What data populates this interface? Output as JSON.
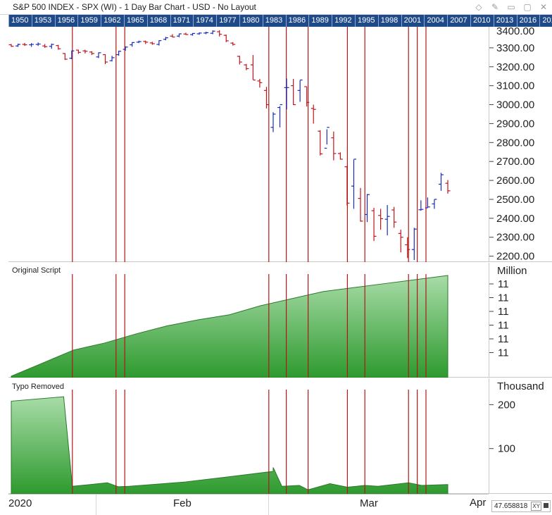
{
  "window": {
    "title": "S&P 500 INDEX - SPX (WI) - 1 Day Bar Chart - USD - No Layout",
    "icons": [
      "diamond-icon",
      "pin-icon",
      "minimize-icon",
      "maximize-icon",
      "close-icon"
    ]
  },
  "year_scroller": [
    "1950",
    "1953",
    "1956",
    "1959",
    "1962",
    "1965",
    "1968",
    "1971",
    "1974",
    "1977",
    "1980",
    "1983",
    "1986",
    "1989",
    "1992",
    "1995",
    "1998",
    "2001",
    "2004",
    "2007",
    "2010",
    "2013",
    "2016",
    "201"
  ],
  "price_panel": {
    "y_ticks": [
      "3300.00",
      "3200.00",
      "3100.00",
      "3000.00",
      "2900.00",
      "2800.00",
      "2700.00",
      "2600.00",
      "2500.00",
      "2400.00",
      "2300.00",
      "2200.00"
    ],
    "top_tick_partial": "3400.00"
  },
  "panel2": {
    "label": "Original Script",
    "unit": "Million",
    "y_ticks": [
      "11",
      "11",
      "11",
      "11",
      "11",
      "11"
    ]
  },
  "panel3": {
    "label": "Typo Removed",
    "unit": "Thousand",
    "y_ticks": [
      "200",
      "100"
    ]
  },
  "x_axis": {
    "ticks": [
      "2020",
      "Feb",
      "Mar"
    ],
    "next": "Apr"
  },
  "readout": {
    "value": "47.658818",
    "mode": "XY"
  },
  "colors": {
    "up": "#1a2bbf",
    "down": "#c0141a",
    "marker_line": "#b01818",
    "area_top": "#a8dca8",
    "area_bottom": "#2e9a2e",
    "year_bar": "#1f4a8a"
  },
  "chart_data": [
    {
      "type": "bar",
      "subtype": "ohlc",
      "title": "S&P 500 INDEX - SPX (WI) - 1 Day Bar Chart - USD",
      "ylim": [
        2180,
        3400
      ],
      "bars": [
        {
          "o": 3316,
          "h": 3320,
          "l": 3305,
          "c": 3308
        },
        {
          "o": 3310,
          "h": 3322,
          "l": 3305,
          "c": 3318
        },
        {
          "o": 3318,
          "h": 3326,
          "l": 3310,
          "c": 3316
        },
        {
          "o": 3316,
          "h": 3325,
          "l": 3305,
          "c": 3318
        },
        {
          "o": 3318,
          "h": 3328,
          "l": 3310,
          "c": 3320
        },
        {
          "o": 3310,
          "h": 3320,
          "l": 3300,
          "c": 3306
        },
        {
          "o": 3308,
          "h": 3322,
          "l": 3295,
          "c": 3318
        },
        {
          "o": 3312,
          "h": 3316,
          "l": 3290,
          "c": 3295
        },
        {
          "o": 3270,
          "h": 3272,
          "l": 3236,
          "c": 3240
        },
        {
          "o": 3245,
          "h": 3286,
          "l": 3240,
          "c": 3284
        },
        {
          "o": 3288,
          "h": 3290,
          "l": 3268,
          "c": 3276
        },
        {
          "o": 3284,
          "h": 3290,
          "l": 3270,
          "c": 3282
        },
        {
          "o": 3278,
          "h": 3282,
          "l": 3262,
          "c": 3270
        },
        {
          "o": 3252,
          "h": 3276,
          "l": 3246,
          "c": 3274
        },
        {
          "o": 3264,
          "h": 3266,
          "l": 3214,
          "c": 3225
        },
        {
          "o": 3232,
          "h": 3258,
          "l": 3228,
          "c": 3248
        },
        {
          "o": 3264,
          "h": 3285,
          "l": 3258,
          "c": 3282
        },
        {
          "o": 3292,
          "h": 3308,
          "l": 3285,
          "c": 3304
        },
        {
          "o": 3316,
          "h": 3330,
          "l": 3306,
          "c": 3328
        },
        {
          "o": 3330,
          "h": 3338,
          "l": 3325,
          "c": 3333
        },
        {
          "o": 3334,
          "h": 3338,
          "l": 3320,
          "c": 3330
        },
        {
          "o": 3326,
          "h": 3332,
          "l": 3316,
          "c": 3322
        },
        {
          "o": 3318,
          "h": 3340,
          "l": 3312,
          "c": 3338
        },
        {
          "o": 3345,
          "h": 3358,
          "l": 3340,
          "c": 3353
        },
        {
          "o": 3362,
          "h": 3372,
          "l": 3355,
          "c": 3357
        },
        {
          "o": 3362,
          "h": 3375,
          "l": 3356,
          "c": 3374
        },
        {
          "o": 3373,
          "h": 3380,
          "l": 3368,
          "c": 3370
        },
        {
          "o": 3370,
          "h": 3378,
          "l": 3364,
          "c": 3376
        },
        {
          "o": 3374,
          "h": 3382,
          "l": 3369,
          "c": 3378
        },
        {
          "o": 3378,
          "h": 3385,
          "l": 3372,
          "c": 3380
        },
        {
          "o": 3377,
          "h": 3392,
          "l": 3372,
          "c": 3388
        },
        {
          "o": 3385,
          "h": 3393,
          "l": 3360,
          "c": 3372
        },
        {
          "o": 3366,
          "h": 3370,
          "l": 3330,
          "c": 3337
        },
        {
          "o": 3325,
          "h": 3330,
          "l": 3312,
          "c": 3318
        },
        {
          "o": 3255,
          "h": 3258,
          "l": 3212,
          "c": 3225
        },
        {
          "o": 3210,
          "h": 3215,
          "l": 3182,
          "c": 3190
        },
        {
          "o": 3210,
          "h": 3262,
          "l": 3132,
          "c": 3130
        },
        {
          "o": 3125,
          "h": 3136,
          "l": 3090,
          "c": 3116
        },
        {
          "o": 3075,
          "h": 3094,
          "l": 2980,
          "c": 3000
        },
        {
          "o": 2880,
          "h": 2960,
          "l": 2855,
          "c": 2950
        },
        {
          "o": 2985,
          "h": 2992,
          "l": 2880,
          "c": 3000
        },
        {
          "o": 3090,
          "h": 3138,
          "l": 2975,
          "c": 3090
        },
        {
          "o": 3100,
          "h": 3136,
          "l": 2998,
          "c": 3000
        },
        {
          "o": 3075,
          "h": 3128,
          "l": 3015,
          "c": 3130
        },
        {
          "o": 3095,
          "h": 3094,
          "l": 2990,
          "c": 3012
        },
        {
          "o": 2980,
          "h": 3000,
          "l": 2900,
          "c": 2975
        },
        {
          "o": 2860,
          "h": 2865,
          "l": 2732,
          "c": 2740
        },
        {
          "o": 2770,
          "h": 2870,
          "l": 2790,
          "c": 2880
        },
        {
          "o": 2825,
          "h": 2858,
          "l": 2706,
          "c": 2742
        },
        {
          "o": 2742,
          "h": 2748,
          "l": 2710,
          "c": 2712
        },
        {
          "o": 2672,
          "h": 2676,
          "l": 2468,
          "c": 2480
        },
        {
          "o": 2570,
          "h": 2710,
          "l": 2450,
          "c": 2712
        },
        {
          "o": 2505,
          "h": 2560,
          "l": 2382,
          "c": 2385
        },
        {
          "o": 2420,
          "h": 2528,
          "l": 2380,
          "c": 2525
        },
        {
          "o": 2440,
          "h": 2455,
          "l": 2280,
          "c": 2305
        },
        {
          "o": 2415,
          "h": 2450,
          "l": 2340,
          "c": 2398
        },
        {
          "o": 2395,
          "h": 2470,
          "l": 2310,
          "c": 2410
        },
        {
          "o": 2444,
          "h": 2460,
          "l": 2350,
          "c": 2380
        },
        {
          "o": 2320,
          "h": 2340,
          "l": 2220,
          "c": 2300
        },
        {
          "o": 2260,
          "h": 2300,
          "l": 2190,
          "c": 2235
        },
        {
          "o": 2235,
          "h": 2350,
          "l": 2180,
          "c": 2343
        },
        {
          "o": 2445,
          "h": 2495,
          "l": 2440,
          "c": 2447
        },
        {
          "o": 2455,
          "h": 2510,
          "l": 2455,
          "c": 2460
        },
        {
          "o": 2476,
          "h": 2500,
          "l": 2450,
          "c": 2500
        },
        {
          "o": 2580,
          "h": 2640,
          "l": 2545,
          "c": 2630
        },
        {
          "o": 2585,
          "h": 2602,
          "l": 2530,
          "c": 2545
        }
      ]
    },
    {
      "type": "area",
      "title": "Original Script",
      "unit": "Million",
      "values": [
        0.0,
        0.13,
        0.26,
        0.33,
        0.42,
        0.5,
        0.56,
        0.61,
        0.7,
        0.77,
        0.84,
        0.88,
        0.92,
        0.96,
        1.0
      ],
      "markers": [
        14,
        24,
        26,
        59,
        63,
        68,
        77,
        81,
        91,
        93,
        95
      ]
    },
    {
      "type": "area",
      "title": "Typo Removed",
      "unit": "Thousand",
      "ylim": [
        0,
        260
      ],
      "values": [
        208,
        218,
        14,
        22,
        13,
        14,
        24,
        36,
        48,
        57,
        14,
        16,
        6,
        20,
        12,
        16,
        14,
        22,
        16,
        18
      ],
      "markers": [
        14,
        24,
        26,
        59,
        63,
        68,
        77,
        81,
        91,
        93,
        95
      ]
    }
  ]
}
